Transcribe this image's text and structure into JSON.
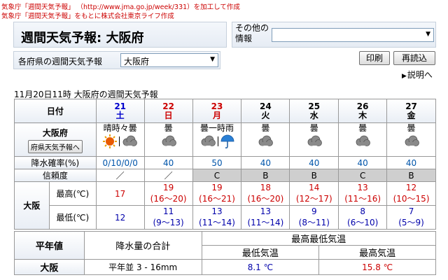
{
  "credits": {
    "line1": "気象庁「週間天気予報」 （http://www.jma.go.jp/week/331）を加工して作成",
    "line2": "気象庁「週間天気予報」をもとに株式会社東京ライフ作成"
  },
  "title": "週間天気予報: 大阪府",
  "other_info": {
    "label": "その他の情報",
    "value": ""
  },
  "pref_selector": {
    "label": "各府県の週間天気予報",
    "value": "大阪府"
  },
  "buttons": {
    "print": "印刷",
    "reload": "再読込"
  },
  "help": "説明へ",
  "timestamp": "11月20日11時  大阪府の週間天気予報",
  "table": {
    "date_header": "日付",
    "region": "大阪府",
    "pref_weather_button": "府県天気予報へ",
    "precip_label": "降水確率(%)",
    "reliability_label": "信頼度",
    "city": "大阪",
    "max_label": "最高(℃)",
    "min_label": "最低(℃)",
    "days": [
      {
        "num": "21",
        "name": "土",
        "color": "#0000cc",
        "weather": "晴時々曇",
        "icon": "sun-cloud",
        "precip": "0/10/0/0",
        "reliability": "／",
        "max": "17",
        "max_range": "",
        "min": "12",
        "min_range": ""
      },
      {
        "num": "22",
        "name": "日",
        "color": "#cc0000",
        "weather": "曇",
        "icon": "cloud",
        "precip": "40",
        "reliability": "／",
        "max": "19",
        "max_range": "(16〜20)",
        "min": "11",
        "min_range": "(9〜13)"
      },
      {
        "num": "23",
        "name": "月",
        "color": "#cc0000",
        "weather": "曇一時雨",
        "icon": "cloud-rain",
        "precip": "50",
        "reliability": "C",
        "max": "19",
        "max_range": "(16〜21)",
        "min": "13",
        "min_range": "(11〜14)"
      },
      {
        "num": "24",
        "name": "火",
        "color": "#000000",
        "weather": "曇",
        "icon": "cloud",
        "precip": "40",
        "reliability": "B",
        "max": "18",
        "max_range": "(16〜20)",
        "min": "13",
        "min_range": "(11〜14)"
      },
      {
        "num": "25",
        "name": "水",
        "color": "#000000",
        "weather": "曇",
        "icon": "cloud",
        "precip": "40",
        "reliability": "B",
        "max": "14",
        "max_range": "(12〜17)",
        "min": "9",
        "min_range": "(8〜11)"
      },
      {
        "num": "26",
        "name": "木",
        "color": "#000000",
        "weather": "曇",
        "icon": "cloud",
        "precip": "40",
        "reliability": "C",
        "max": "13",
        "max_range": "(11〜16)",
        "min": "8",
        "min_range": "(6〜10)"
      },
      {
        "num": "27",
        "name": "金",
        "color": "#000000",
        "weather": "曇",
        "icon": "cloud",
        "precip": "40",
        "reliability": "B",
        "max": "12",
        "max_range": "(10〜15)",
        "min": "7",
        "min_range": "(5〜9)"
      }
    ]
  },
  "normals": {
    "title": "平年値",
    "precip_total_label": "降水量の合計",
    "temp_label": "最高最低気温",
    "min_label": "最低気温",
    "max_label": "最高気温",
    "city": "大阪",
    "precip_value": "平年並 3 - 16mm",
    "min_value": "8.1 ℃",
    "max_value": "15.8 ℃"
  }
}
